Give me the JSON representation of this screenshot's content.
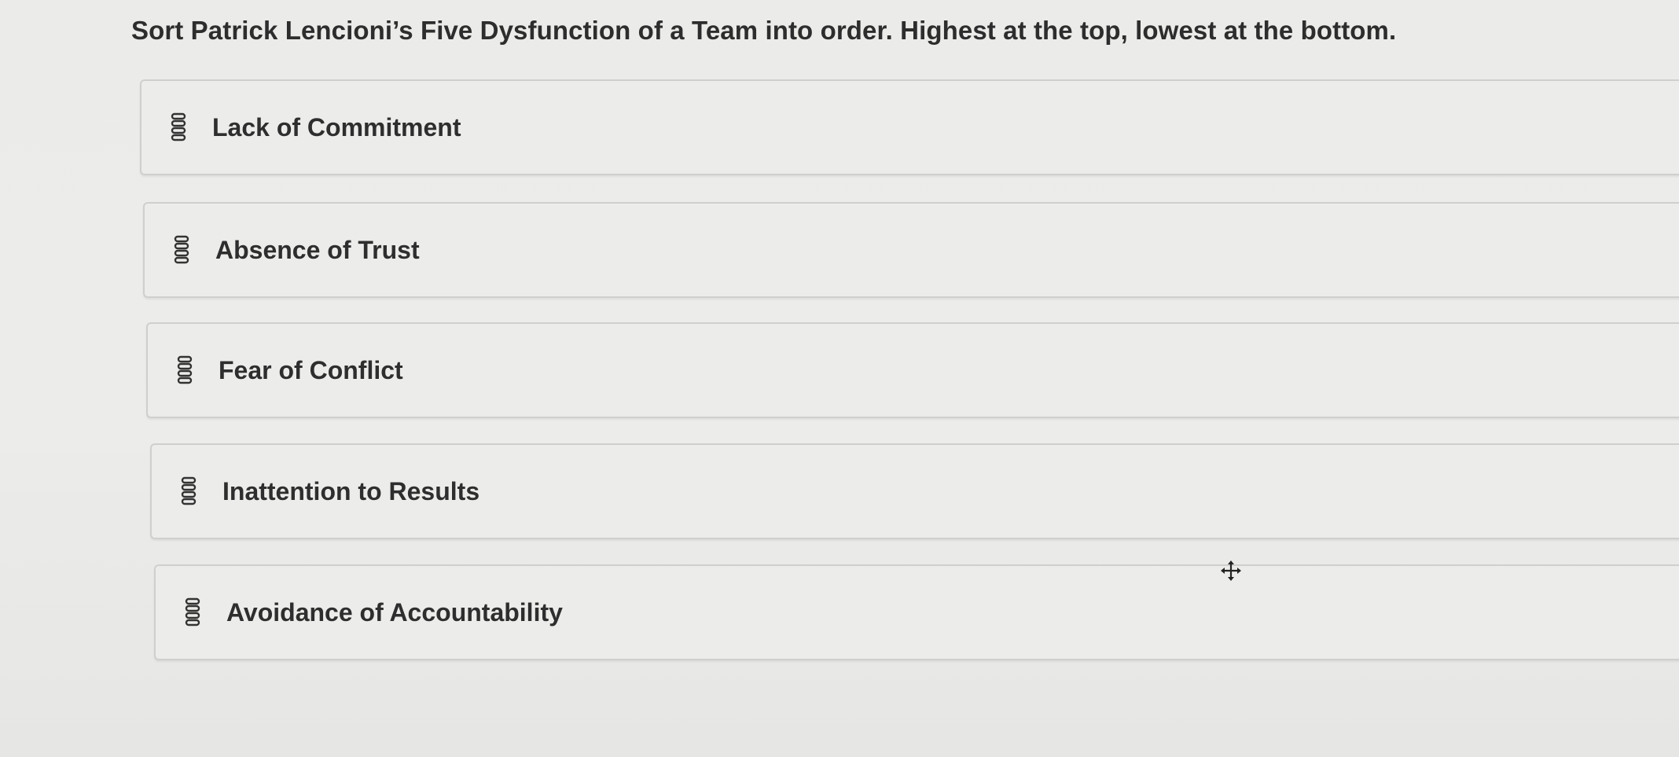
{
  "question": {
    "text": "Sort Patrick Lencioni’s Five Dysfunction of a Team into order. Highest at the top, lowest at the bottom."
  },
  "sort_items": [
    {
      "label": "Lack of Commitment",
      "handle_icon": "drag-handle-icon"
    },
    {
      "label": "Absence of Trust",
      "handle_icon": "drag-handle-icon"
    },
    {
      "label": "Fear of Conflict",
      "handle_icon": "drag-handle-icon"
    },
    {
      "label": "Inattention to Results",
      "handle_icon": "drag-handle-icon"
    },
    {
      "label": "Avoidance of Accountability",
      "handle_icon": "drag-handle-icon"
    }
  ],
  "cursor": {
    "icon": "move-cursor-icon"
  },
  "colors": {
    "background": "#ebebe9",
    "item_border": "#cfcfcd",
    "text": "#2d2d2d"
  }
}
